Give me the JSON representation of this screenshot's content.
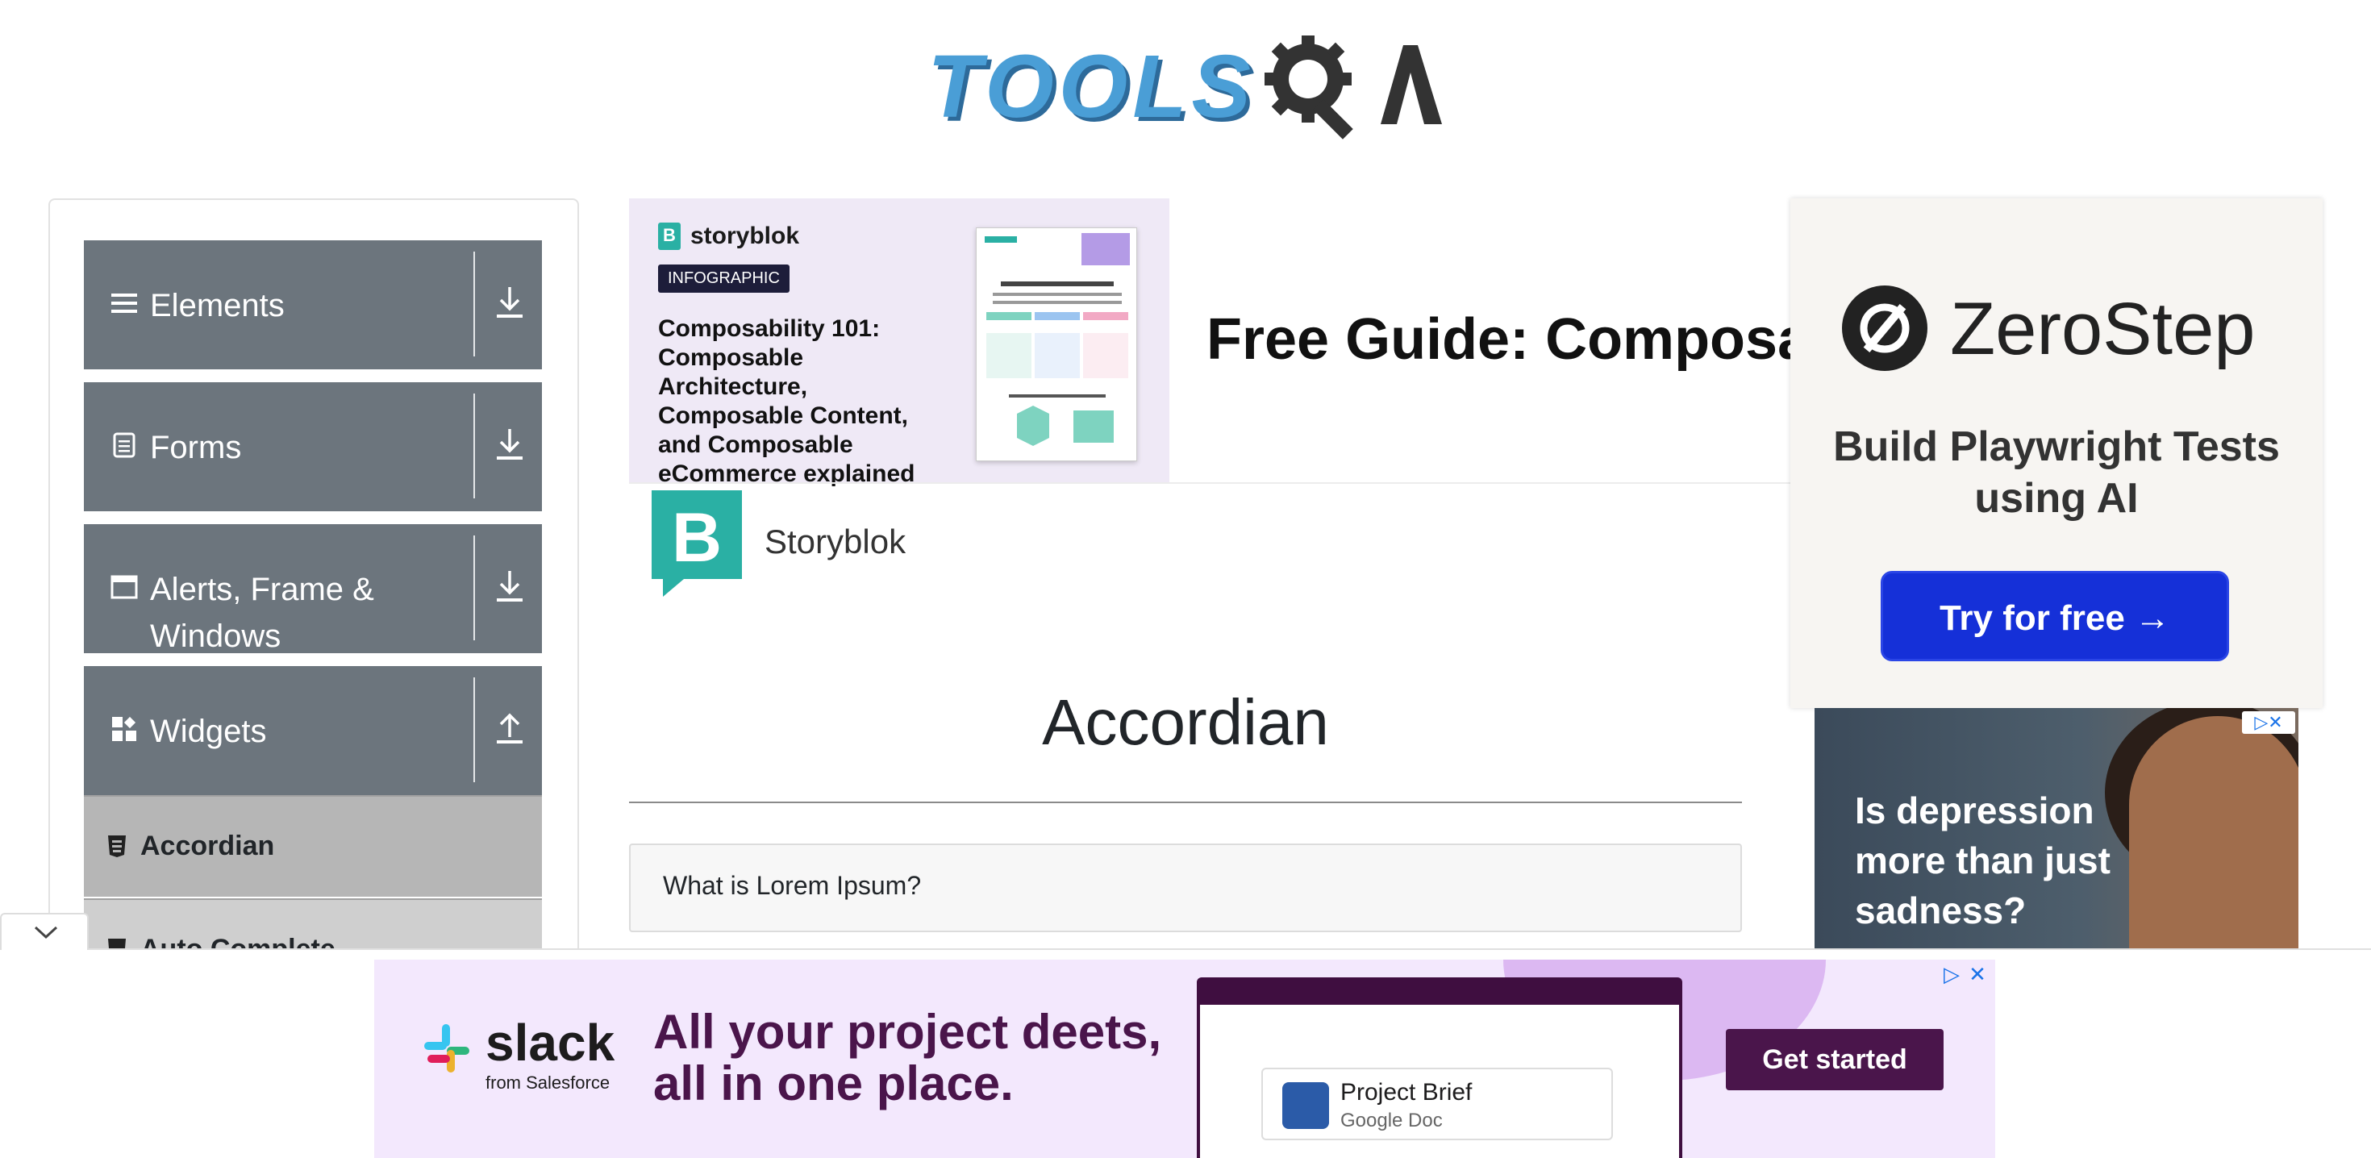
{
  "header": {
    "logo_text": "TOOLS",
    "logo_tail": "A"
  },
  "sidebar": {
    "groups": [
      {
        "label": "Elements",
        "icon": "hamburger-icon",
        "state": "collapsed"
      },
      {
        "label": "Forms",
        "icon": "document-icon",
        "state": "collapsed"
      },
      {
        "label": "Alerts, Frame & Windows",
        "icon": "window-icon",
        "state": "collapsed"
      },
      {
        "label": "Widgets",
        "icon": "widgets-icon",
        "state": "expanded"
      }
    ],
    "items": [
      {
        "label": "Accordian",
        "active": true
      },
      {
        "label": "Auto Complete",
        "active": false
      }
    ]
  },
  "ad_storyblok": {
    "brand": "storyblok",
    "tag": "INFOGRAPHIC",
    "headline": "Composability 101: Composable Architecture, Composable Content, and Composable eCommerce explained",
    "guide": "Free Guide: Composab",
    "sponsor": "Storyblok"
  },
  "main": {
    "title": "Accordian",
    "first_question": "What is Lorem Ipsum?"
  },
  "ad_zerostep": {
    "brand": "ZeroStep",
    "tagline": "Build Playwright Tests using AI",
    "cta": "Try for free →"
  },
  "ad_depression": {
    "text": "Is depression more than just sadness?"
  },
  "ad_slack": {
    "brand": "slack",
    "from": "from Salesforce",
    "headline": "All your project deets, all in one place.",
    "doc_title": "Project Brief",
    "doc_sub": "Google Doc",
    "cta": "Get started"
  },
  "colors": {
    "sidebar_group_bg": "#6c757d",
    "active_item_bg": "#b6b6b6",
    "zerostep_button": "#1530d8",
    "slack_purple": "#4a154b"
  }
}
